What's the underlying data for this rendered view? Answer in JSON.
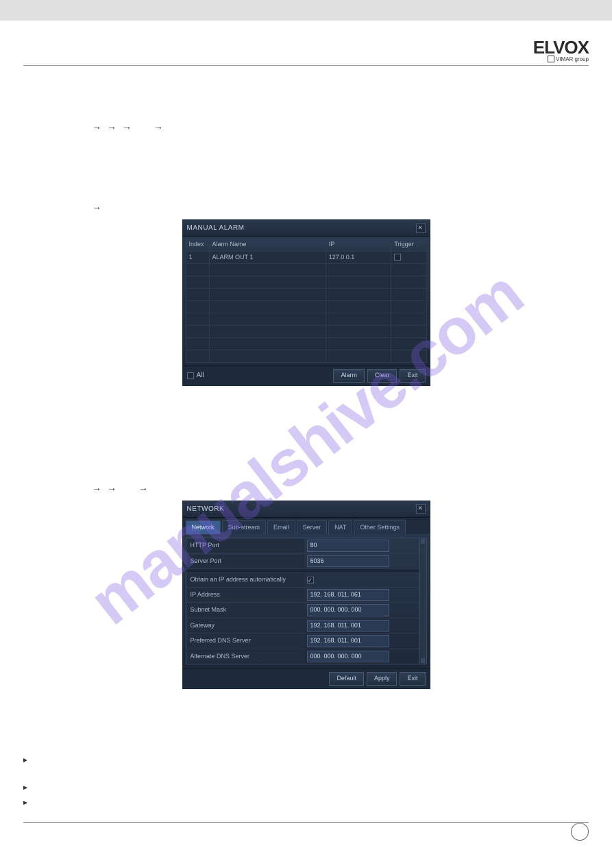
{
  "brand": {
    "name": "ELVOX",
    "group": "VIMAR group"
  },
  "watermark": "manualshive.com",
  "nav1": {
    "a": "",
    "b": "",
    "c": "",
    "d": ""
  },
  "nav2": {
    "a": ""
  },
  "nav3": {
    "a": "",
    "b": "",
    "c": ""
  },
  "bullets": {
    "b1": "",
    "b2": "",
    "b3": ""
  },
  "alarmDialog": {
    "title": "MANUAL ALARM",
    "columns": {
      "index": "Index",
      "name": "Alarm Name",
      "ip": "IP",
      "trigger": "Trigger"
    },
    "row": {
      "index": "1",
      "name": "ALARM OUT 1",
      "ip": "127.0.0.1"
    },
    "allLabel": "All",
    "btnAlarm": "Alarm",
    "btnClear": "Clear",
    "btnExit": "Exit"
  },
  "networkDialog": {
    "title": "NETWORK",
    "tabs": {
      "network": "Network",
      "substream": "Sub-stream",
      "email": "Email",
      "server": "Server",
      "nat": "NAT",
      "other": "Other Settings"
    },
    "fields": {
      "httpPort": {
        "label": "HTTP Port",
        "value": "80"
      },
      "serverPort": {
        "label": "Server Port",
        "value": "6036"
      },
      "obtainAuto": {
        "label": "Obtain an IP address automatically"
      },
      "ipAddress": {
        "label": "IP Address",
        "value": "192. 168. 011. 061"
      },
      "subnetMask": {
        "label": "Subnet Mask",
        "value": "000. 000. 000. 000"
      },
      "gateway": {
        "label": "Gateway",
        "value": "192. 168. 011. 001"
      },
      "prefDns": {
        "label": "Preferred DNS Server",
        "value": "192. 168. 011. 001"
      },
      "altDns": {
        "label": "Alternate DNS Server",
        "value": "000. 000. 000. 000"
      }
    },
    "btnDefault": "Default",
    "btnApply": "Apply",
    "btnExit": "Exit"
  }
}
